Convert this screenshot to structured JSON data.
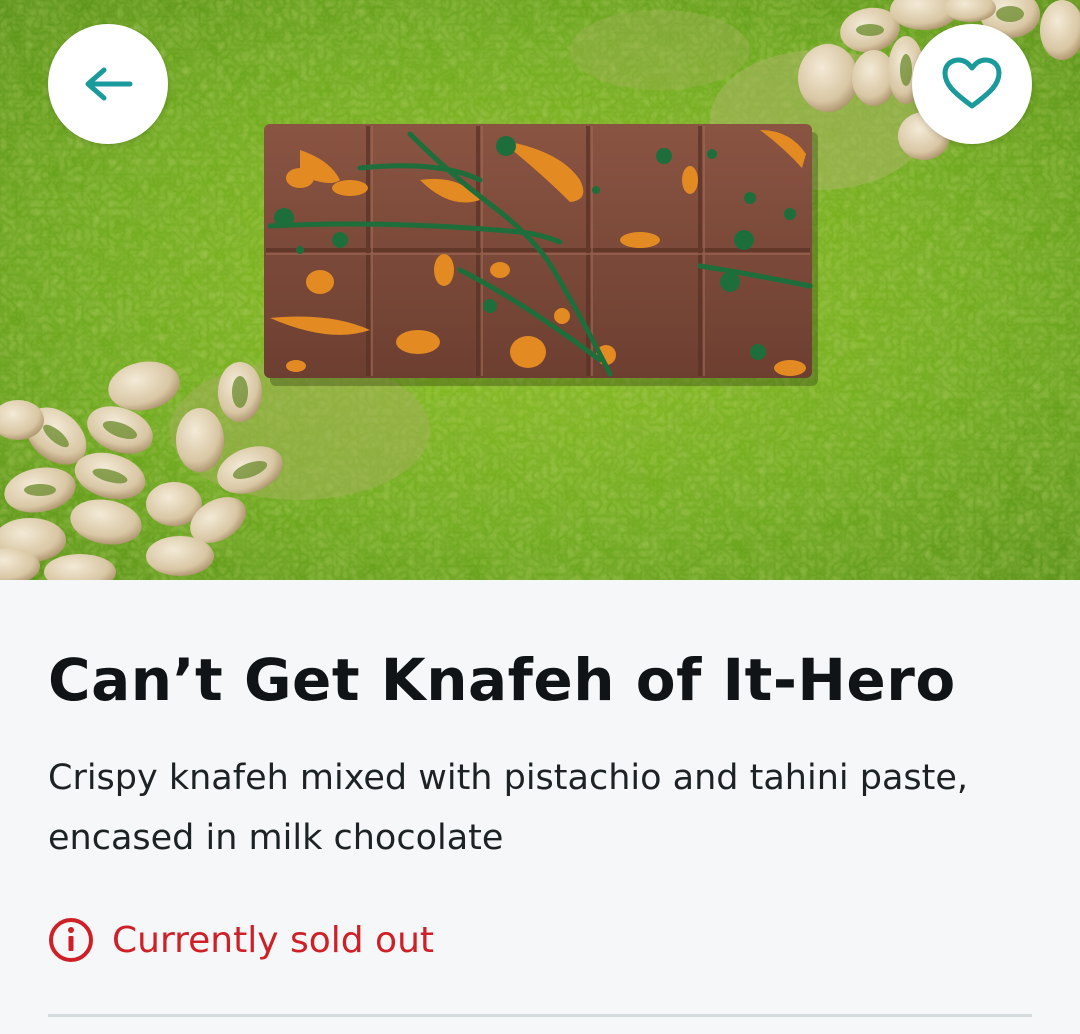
{
  "hero": {
    "image_description_name": "product-photo",
    "back_icon": "arrow-left-icon",
    "favorite_icon": "heart-outline-icon"
  },
  "product": {
    "title": "Can’t Get Knafeh of It-Hero",
    "description": "Crispy knafeh mixed with pistachio and tahini paste, encased in milk chocolate",
    "status_icon": "info-circle-icon",
    "status_text": "Currently sold out"
  },
  "colors": {
    "accent": "#1a9a9a",
    "sold_out": "#cf1f27",
    "title": "#101416",
    "body_text": "#1d2225",
    "background": "#f5f7f8"
  }
}
